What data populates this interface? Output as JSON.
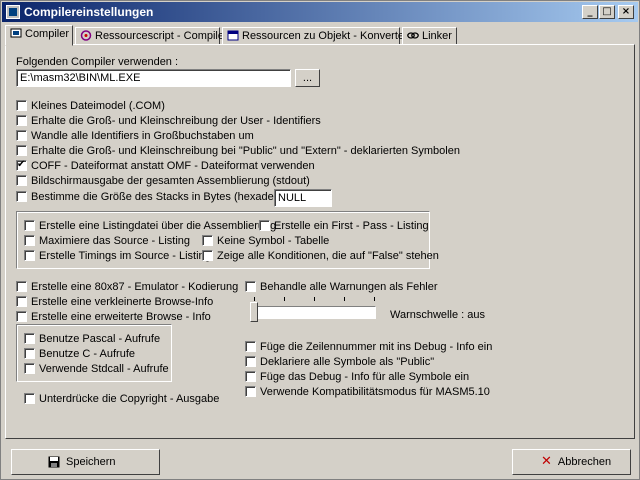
{
  "window": {
    "title": "Compilereinstellungen"
  },
  "tabs": [
    {
      "label": "Compiler",
      "icon": "compiler-icon"
    },
    {
      "label": "Ressourcescript - Compiler",
      "icon": "resource-script-icon"
    },
    {
      "label": "Ressourcen zu Objekt - Konverter",
      "icon": "resource-object-icon"
    },
    {
      "label": "Linker",
      "icon": "linker-icon"
    }
  ],
  "compiler": {
    "path_label": "Folgenden Compiler verwenden :",
    "path_value": "E:\\masm32\\BIN\\ML.EXE",
    "browse_label": "...",
    "options": [
      {
        "label": "Kleines Dateimodel (.COM)",
        "checked": false
      },
      {
        "label": "Erhalte die Groß- und Kleinschreibung der User - Identifiers",
        "checked": false
      },
      {
        "label": "Wandle alle Identifiers in Großbuchstaben um",
        "checked": false
      },
      {
        "label": "Erhalte die Groß- und Kleinschreibung bei \"Public\" und \"Extern\" - deklarierten Symbolen",
        "checked": false
      },
      {
        "label": "COFF - Dateiformat anstatt OMF - Dateiformat verwenden",
        "checked": true
      },
      {
        "label": "Bildschirmausgabe der gesamten Assemblierung (stdout)",
        "checked": false
      },
      {
        "label": "Bestimme die Größe des Stacks in Bytes (hexadezimal)",
        "checked": false
      }
    ],
    "stack_value": "NULL",
    "listing_left": [
      {
        "label": "Erstelle eine Listingdatei über die Assemblierung",
        "checked": false
      },
      {
        "label": "Maximiere das Source - Listing",
        "checked": false
      },
      {
        "label": "Erstelle Timings im Source - Listing",
        "checked": false
      }
    ],
    "listing_right": [
      {
        "label": "Erstelle ein First - Pass - Listing",
        "checked": false
      },
      {
        "label": "Keine Symbol - Tabelle",
        "checked": false
      },
      {
        "label": "Zeige alle Konditionen, die auf \"False\" stehen",
        "checked": false
      }
    ],
    "misc_left": [
      {
        "label": "Erstelle eine 80x87 - Emulator - Kodierung",
        "checked": false
      },
      {
        "label": "Erstelle eine verkleinerte Browse-Info",
        "checked": false
      },
      {
        "label": "Erstelle eine erweiterte Browse - Info",
        "checked": false
      }
    ],
    "call_group": [
      {
        "label": "Benutze Pascal - Aufrufe",
        "checked": false
      },
      {
        "label": "Benutze C - Aufrufe",
        "checked": false
      },
      {
        "label": "Verwende Stdcall - Aufrufe",
        "checked": false
      }
    ],
    "copyright": {
      "label": "Unterdrücke die Copyright - Ausgabe",
      "checked": false
    },
    "warnings_as_errors": {
      "label": "Behandle alle Warnungen als Fehler",
      "checked": false
    },
    "warning_level_label": "Warnschwelle : aus",
    "warning_level": 0,
    "misc_right": [
      {
        "label": "Füge die Zeilennummer mit ins Debug - Info ein",
        "checked": false
      },
      {
        "label": "Deklariere alle Symbole als \"Public\"",
        "checked": false
      },
      {
        "label": "Füge das Debug - Info für alle Symbole ein",
        "checked": false
      },
      {
        "label": "Verwende Kompatibilitätsmodus für MASM5.10",
        "checked": false
      }
    ]
  },
  "footer": {
    "save_label": "Speichern",
    "cancel_label": "Abbrechen"
  }
}
